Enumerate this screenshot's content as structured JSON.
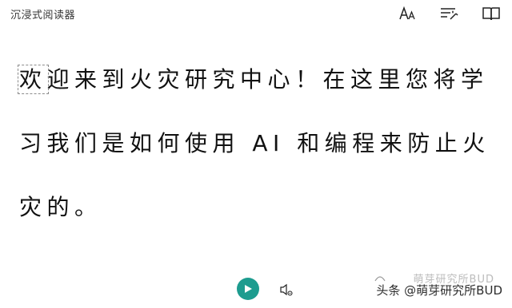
{
  "app": {
    "title": "沉浸式阅读器"
  },
  "toolbar": {
    "icons": [
      "text-size-icon",
      "grammar-options-icon",
      "reading-preferences-icon"
    ]
  },
  "reader": {
    "first_char": "欢",
    "text_rest": "迎来到火灾研究中心！在这里您将学习我们是如何使用 AI 和编程来防止火灾的。"
  },
  "playback": {
    "play_icon": "play-icon",
    "settings_icon": "voice-settings-icon",
    "accent_color": "#1d9c8f"
  },
  "watermark": {
    "credit": "头条 @萌芽研究所BUD",
    "ghost": "萌芽研究所BUD"
  }
}
